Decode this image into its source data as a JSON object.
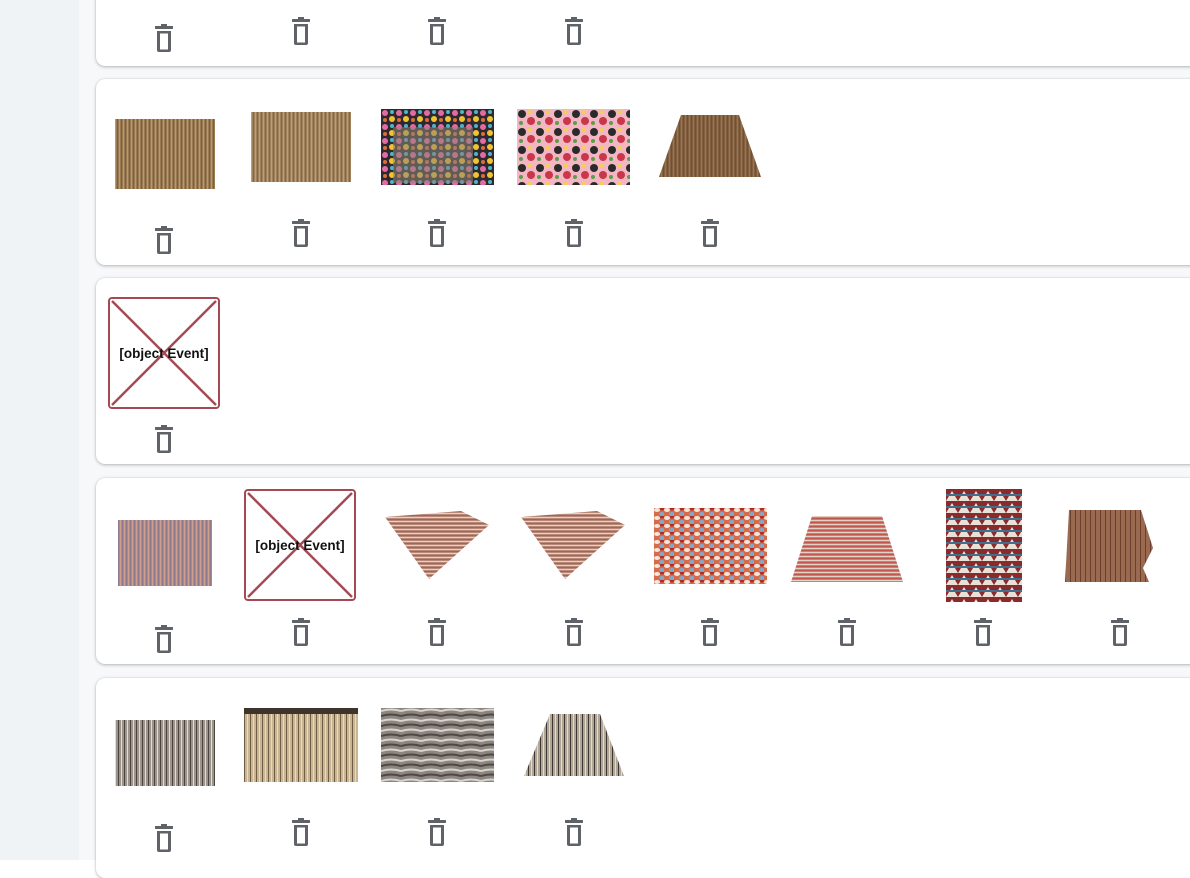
{
  "rows": [
    {
      "thumbnails": [
        "rug-partial-1",
        "rug-partial-2",
        "rug-partial-3",
        "rug-partial-4"
      ]
    },
    {
      "thumbnails": [
        "rug-gold-flat",
        "rug-gold-flat-2",
        "rug-multicolor-back",
        "rug-floral-closeup",
        "rug-brown-perspective"
      ]
    },
    {
      "thumbnails": [
        "broken-image"
      ]
    },
    {
      "thumbnails": [
        "rug-pink-stripe",
        "broken-image",
        "rug-diamond-1",
        "rug-diamond-2",
        "rug-texture-closeup",
        "rug-red-perspective",
        "rug-folded-pattern",
        "rug-corner-fold"
      ]
    },
    {
      "thumbnails": [
        "rug-grey-stripe",
        "rug-beige-fringe",
        "rug-shag-closeup",
        "rug-runner-perspective"
      ]
    }
  ],
  "broken_image_text": "[object Event]",
  "icons": {
    "delete": "trash-icon"
  },
  "colors": {
    "sidebar": "#f0f3f6",
    "broken_border": "#a34a55",
    "icon": "#5f6368"
  }
}
